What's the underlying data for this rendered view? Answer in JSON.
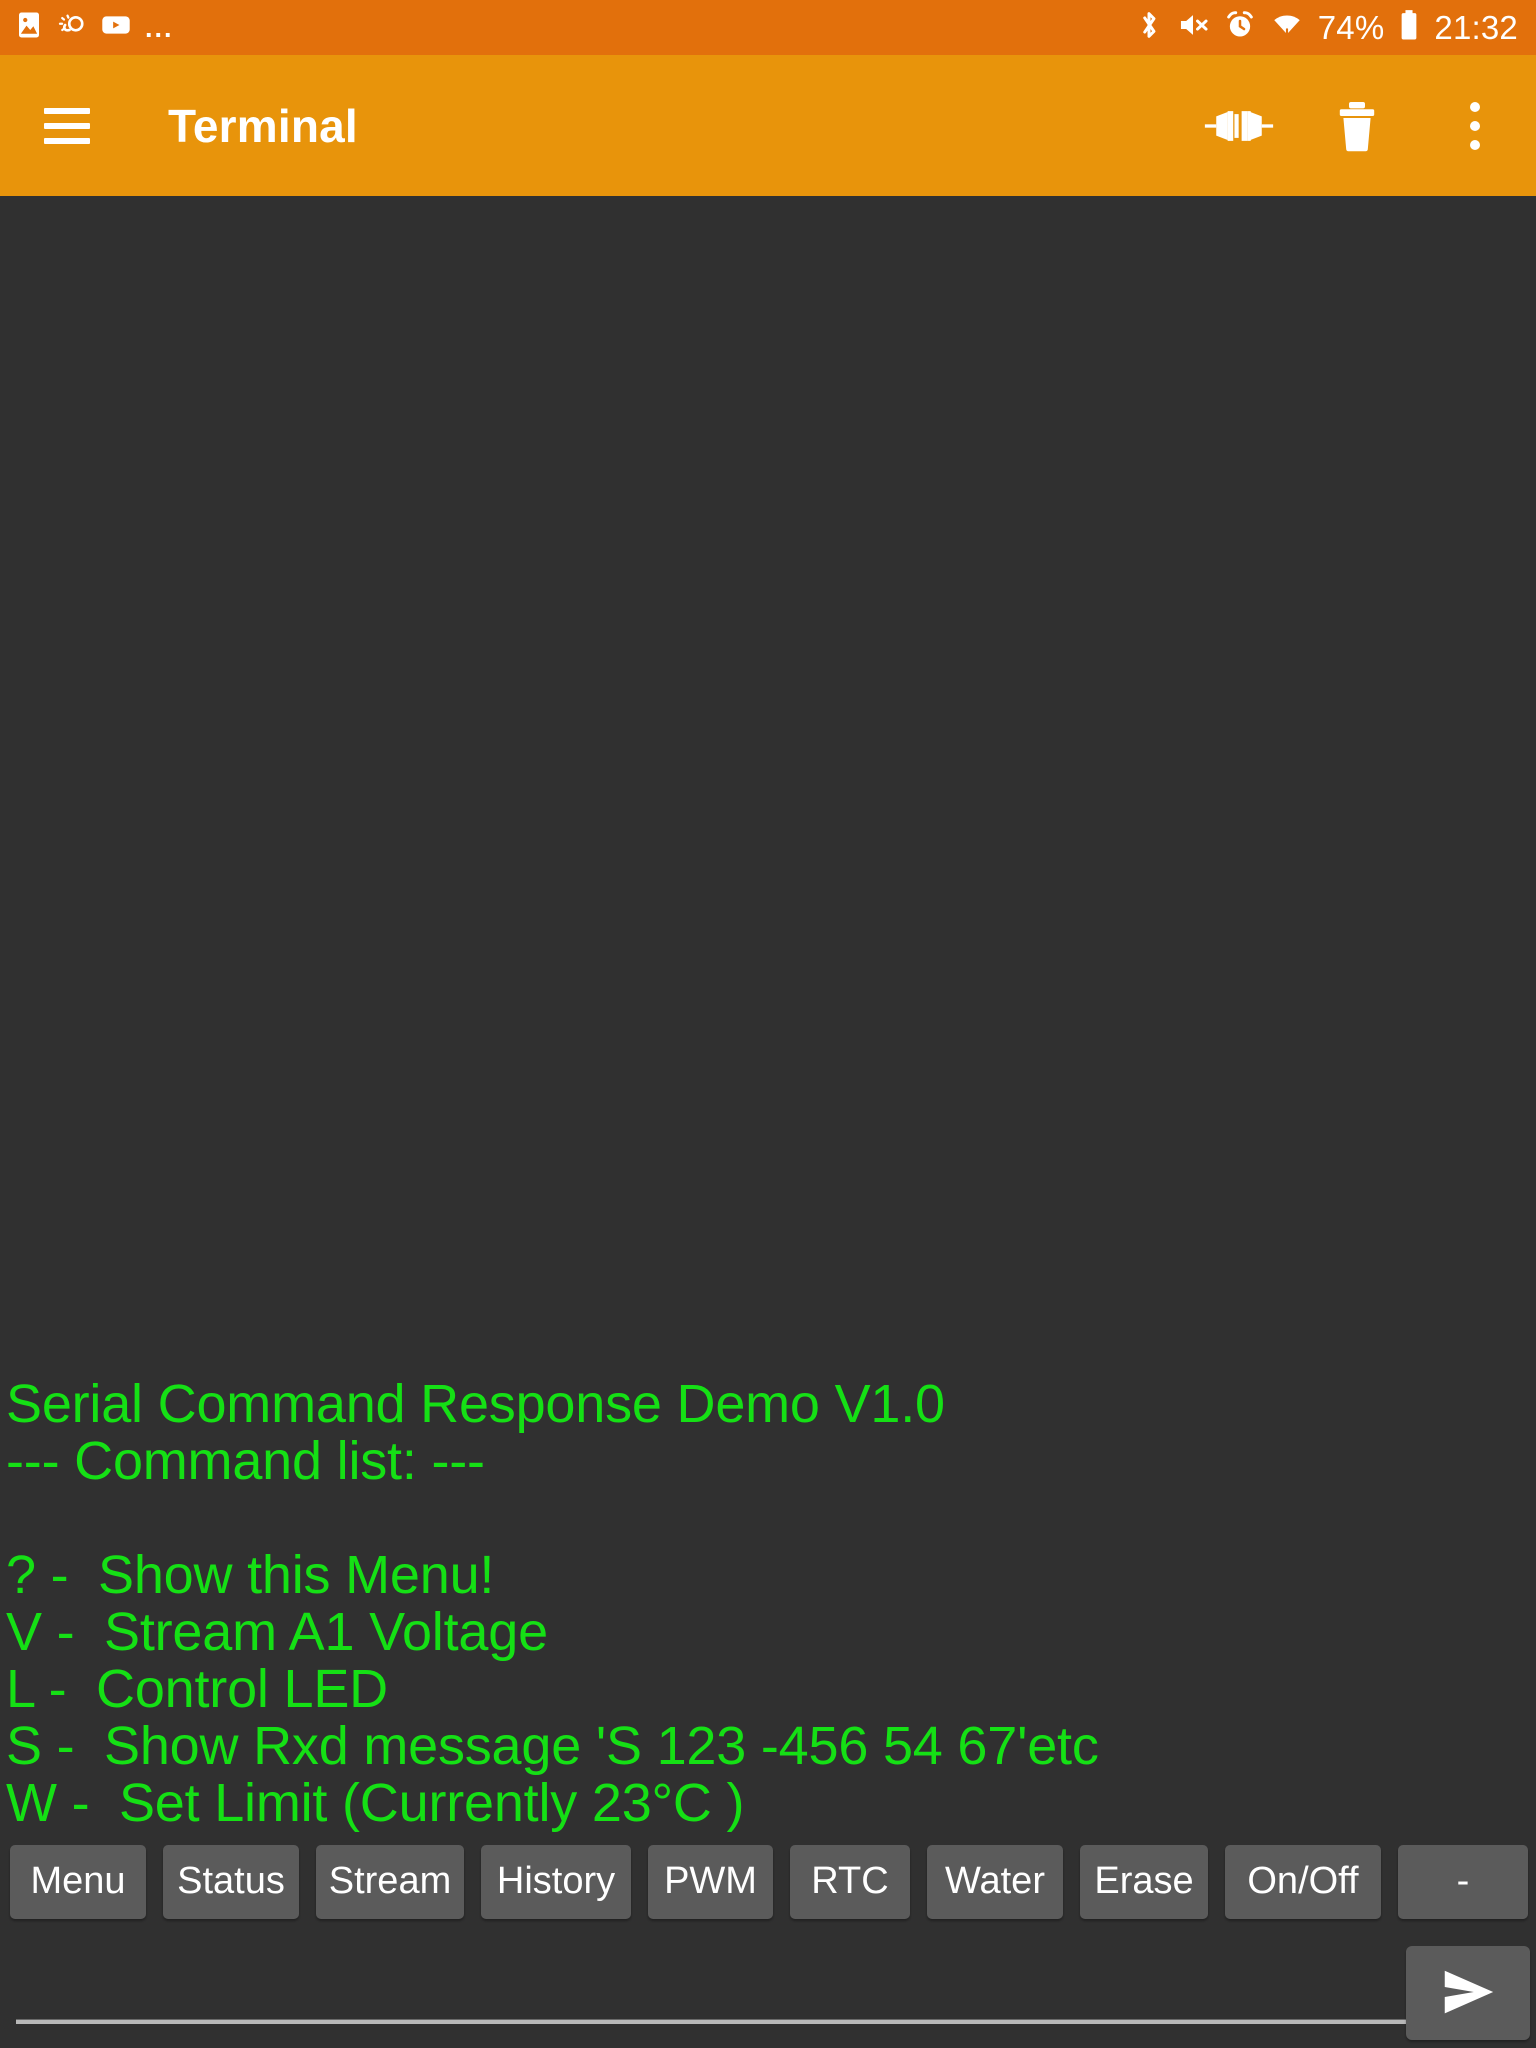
{
  "statusbar": {
    "left_icons": [
      "image-icon",
      "weather-icon",
      "youtube-icon"
    ],
    "overflow_ellipsis": "...",
    "right_icons": [
      "bluetooth-icon",
      "volume-muted-icon",
      "alarm-clock-icon",
      "wifi-icon"
    ],
    "battery_percent": "74%",
    "battery_icon": "battery-icon",
    "clock": "21:32",
    "background_color": "#E2700C",
    "foreground_color": "#FFFFFF"
  },
  "appbar": {
    "menu_icon": "hamburger-menu-icon",
    "title": "Terminal",
    "actions": [
      {
        "name": "connect-icon",
        "label": "Connect"
      },
      {
        "name": "delete-icon",
        "label": "Clear"
      },
      {
        "name": "overflow-menu-icon",
        "label": "More options"
      }
    ],
    "background_color": "#E8940B",
    "foreground_color": "#FFFFFF"
  },
  "terminal": {
    "background_color": "#303030",
    "text_color": "#15E015",
    "lines": [
      "Serial Command Response Demo V1.0",
      "--- Command list: ---",
      "",
      "? -  Show this Menu!",
      "V -  Stream A1 Voltage",
      "L -  Control LED",
      "S -  Show Rxd message 'S 123 -456 54 67'etc",
      "W -  Set Limit (Currently 23°C )"
    ]
  },
  "quick_buttons": [
    {
      "label": "Menu",
      "cls": "w-menu"
    },
    {
      "label": "Status",
      "cls": "w-status"
    },
    {
      "label": "Stream",
      "cls": "w-stream"
    },
    {
      "label": "History",
      "cls": "w-history"
    },
    {
      "label": "PWM",
      "cls": "w-pwm"
    },
    {
      "label": "RTC",
      "cls": "w-rtc"
    },
    {
      "label": "Water",
      "cls": "w-water"
    },
    {
      "label": "Erase",
      "cls": "w-erase"
    },
    {
      "label": "On/Off",
      "cls": "w-onoff"
    },
    {
      "label": "-",
      "cls": "w-dash"
    }
  ],
  "input": {
    "value": "",
    "placeholder": "",
    "send_icon": "send-icon",
    "button_color": "#5B5B5B"
  }
}
